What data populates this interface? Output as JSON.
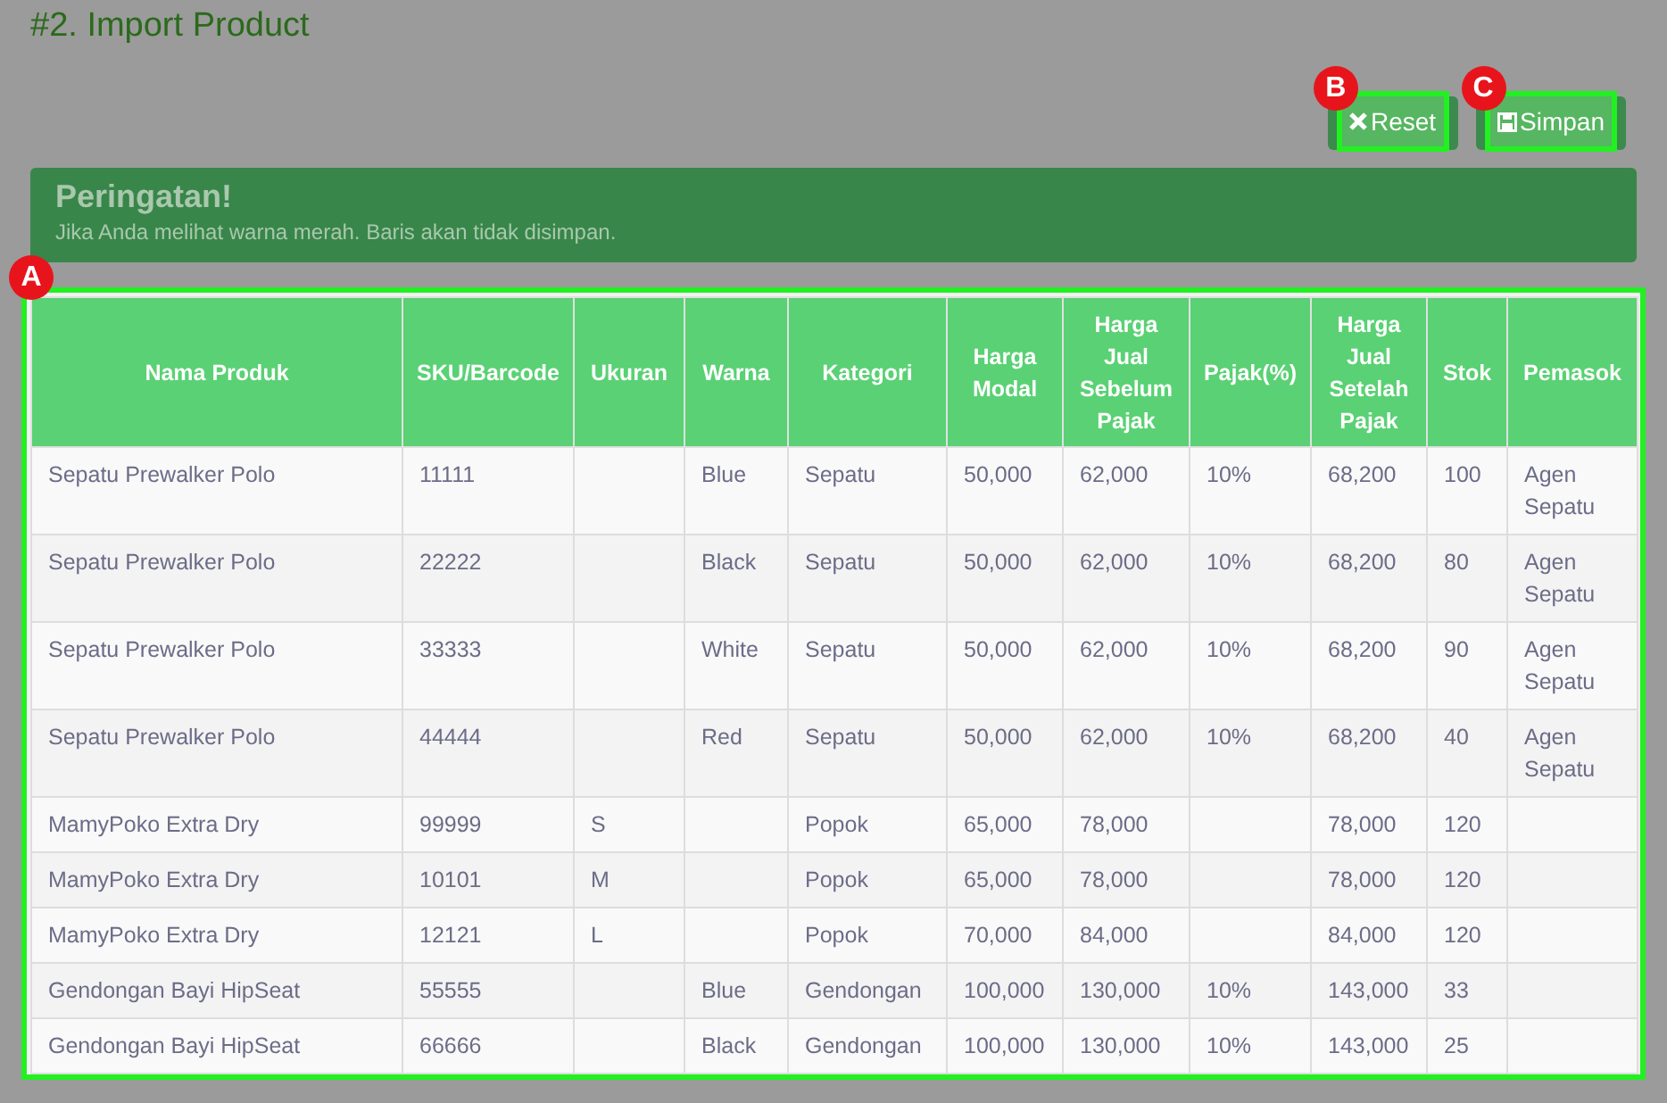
{
  "title": "#2. Import Product",
  "buttons": [
    {
      "label": "Reset",
      "kind": "reset",
      "callout": "B"
    },
    {
      "label": "Simpan",
      "kind": "save",
      "callout": "C"
    }
  ],
  "alert": {
    "heading": "Peringatan!",
    "message": "Jika Anda melihat warna merah. Baris akan tidak disimpan."
  },
  "table": {
    "callout": "A",
    "columns": [
      "Nama Produk",
      "SKU/Barcode",
      "Ukuran",
      "Warna",
      "Kategori",
      "Harga Modal",
      "Harga Jual Sebelum Pajak",
      "Pajak(%)",
      "Harga Jual Setelah Pajak",
      "Stok",
      "Pemasok"
    ],
    "rows": [
      [
        "Sepatu Prewalker Polo",
        "11111",
        "",
        "Blue",
        "Sepatu",
        "50,000",
        "62,000",
        "10%",
        "68,200",
        "100",
        "Agen Sepatu"
      ],
      [
        "Sepatu Prewalker Polo",
        "22222",
        "",
        "Black",
        "Sepatu",
        "50,000",
        "62,000",
        "10%",
        "68,200",
        "80",
        "Agen Sepatu"
      ],
      [
        "Sepatu Prewalker Polo",
        "33333",
        "",
        "White",
        "Sepatu",
        "50,000",
        "62,000",
        "10%",
        "68,200",
        "90",
        "Agen Sepatu"
      ],
      [
        "Sepatu Prewalker Polo",
        "44444",
        "",
        "Red",
        "Sepatu",
        "50,000",
        "62,000",
        "10%",
        "68,200",
        "40",
        "Agen Sepatu"
      ],
      [
        "MamyPoko Extra Dry",
        "99999",
        "S",
        "",
        "Popok",
        "65,000",
        "78,000",
        "",
        "78,000",
        "120",
        ""
      ],
      [
        "MamyPoko Extra Dry",
        "10101",
        "M",
        "",
        "Popok",
        "65,000",
        "78,000",
        "",
        "78,000",
        "120",
        ""
      ],
      [
        "MamyPoko Extra Dry",
        "12121",
        "L",
        "",
        "Popok",
        "70,000",
        "84,000",
        "",
        "84,000",
        "120",
        ""
      ],
      [
        "Gendongan Bayi HipSeat",
        "55555",
        "",
        "Blue",
        "Gendongan",
        "100,000",
        "130,000",
        "10%",
        "143,000",
        "33",
        ""
      ],
      [
        "Gendongan Bayi HipSeat",
        "66666",
        "",
        "Black",
        "Gendongan",
        "100,000",
        "130,000",
        "10%",
        "143,000",
        "25",
        ""
      ]
    ]
  }
}
